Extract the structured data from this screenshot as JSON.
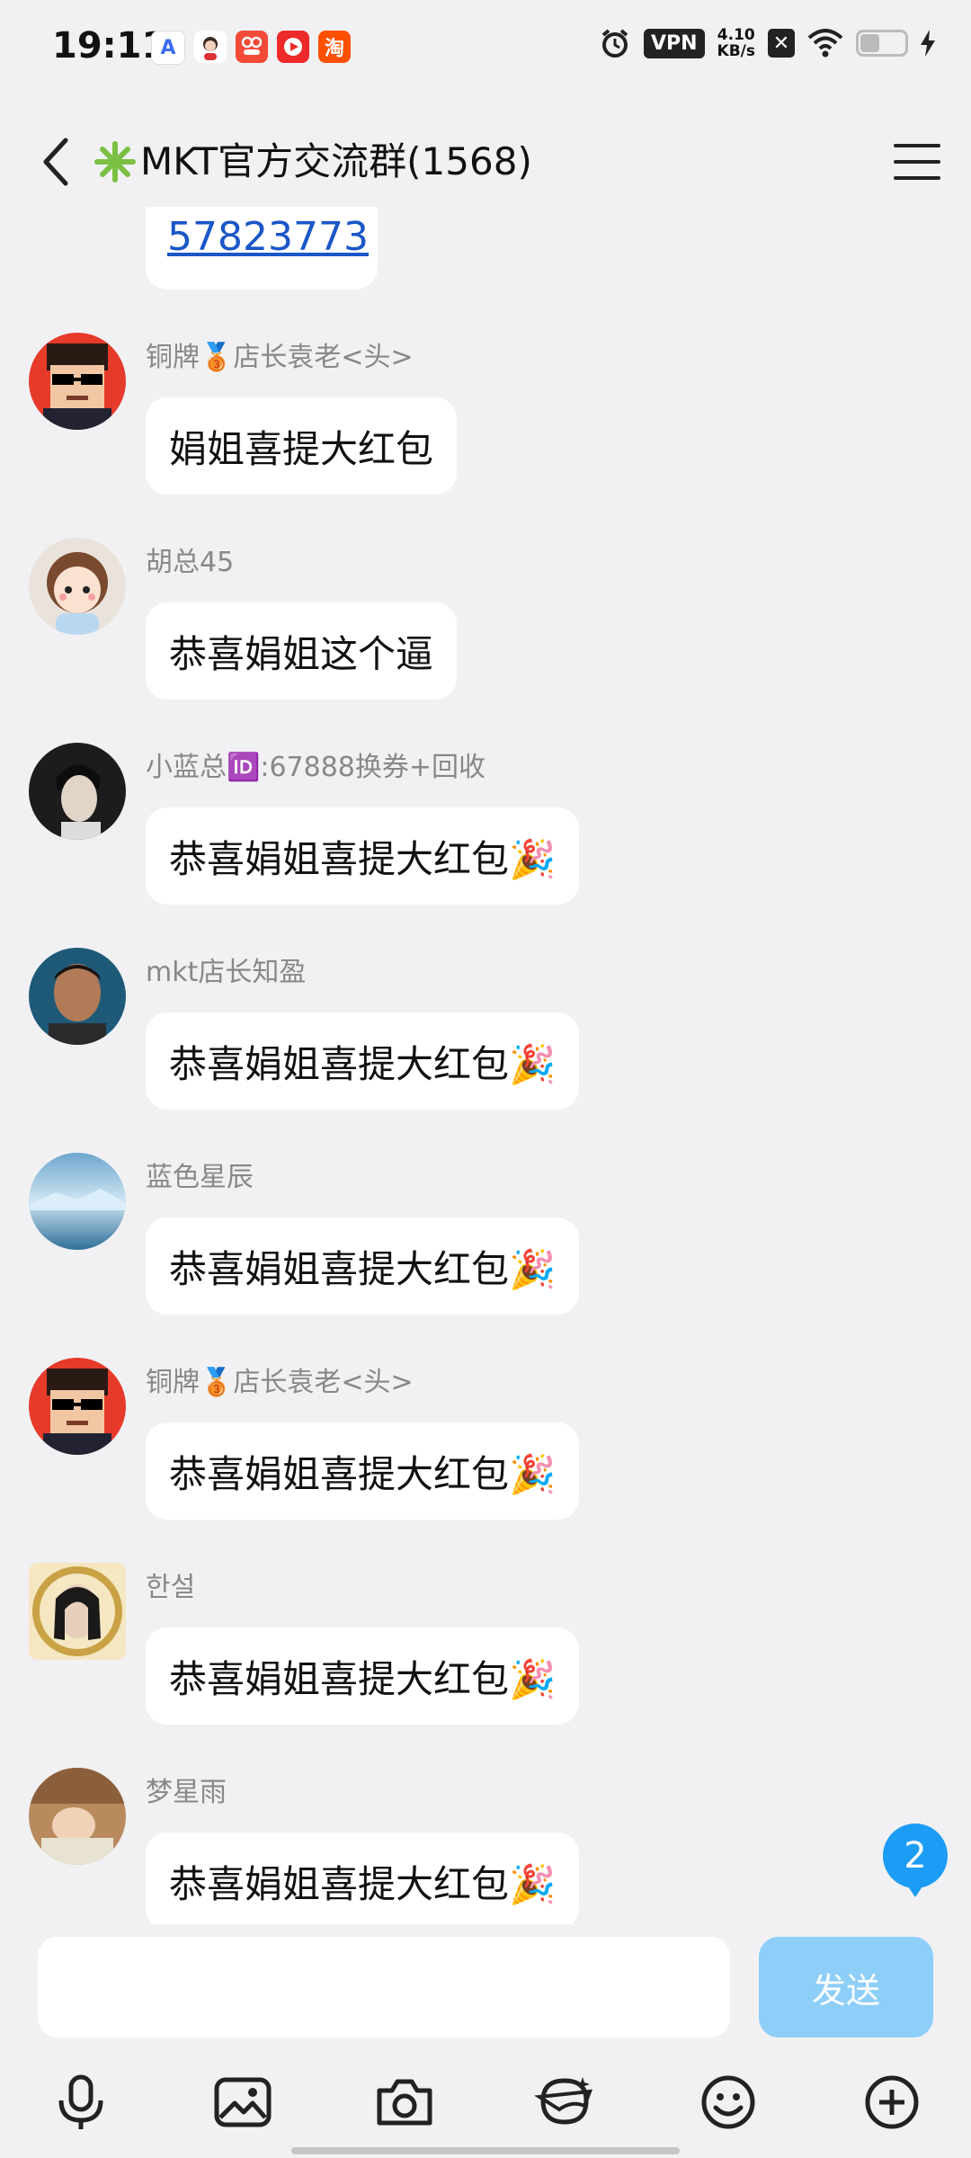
{
  "status_bar": {
    "time": "19:11",
    "vpn_label": "VPN",
    "net_speed_value": "4.10",
    "net_speed_unit": "KB/s",
    "app_icons": [
      "a-app-icon",
      "avatar-app-icon",
      "pinduoduo-icon",
      "video-app-icon",
      "taobao-icon"
    ],
    "taobao_char": "淘",
    "battery_level": 0.4
  },
  "header": {
    "title": "MKT官方交流群(1568)",
    "title_prefix_icon": "green-star-icon"
  },
  "chat": {
    "partial_message_link": "57823773",
    "messages": [
      {
        "sender": "铜牌🥉店长袁老<头>",
        "text": "娟姐喜提大红包",
        "avatar": "pixel-sunglasses-avatar"
      },
      {
        "sender": "胡总45",
        "text": "恭喜娟姐这个逼",
        "avatar": "cartoon-girl-avatar"
      },
      {
        "sender": "小蓝总🆔:67888换券+回收",
        "text": "恭喜娟姐喜提大红包🎉",
        "avatar": "man-portrait-avatar"
      },
      {
        "sender": "mkt店长知盈",
        "text": "恭喜娟姐喜提大红包🎉",
        "avatar": "man-photo-avatar"
      },
      {
        "sender": "蓝色星辰",
        "text": "恭喜娟姐喜提大红包🎉",
        "avatar": "blue-landscape-avatar"
      },
      {
        "sender": "铜牌🥉店长袁老<头>",
        "text": "恭喜娟姐喜提大红包🎉",
        "avatar": "pixel-sunglasses-avatar"
      },
      {
        "sender": "한설",
        "text": "恭喜娟姐喜提大红包🎉",
        "avatar": "woman-gold-frame-avatar"
      },
      {
        "sender": "梦星雨",
        "text": "恭喜娟姐喜提大红包🎉",
        "avatar": "baby-photo-avatar"
      }
    ],
    "unread_count": "2"
  },
  "input": {
    "placeholder": "",
    "value": "",
    "send_label": "发送"
  },
  "toolbar": {
    "items": [
      "microphone-icon",
      "image-icon",
      "camera-icon",
      "sticker-icon",
      "emoji-icon",
      "plus-icon"
    ]
  },
  "colors": {
    "background": "#f1f1f4",
    "link": "#1a56c7",
    "send_button": "#8ecff9",
    "badge": "#1c9cf5",
    "title_star": "#7bc043"
  }
}
